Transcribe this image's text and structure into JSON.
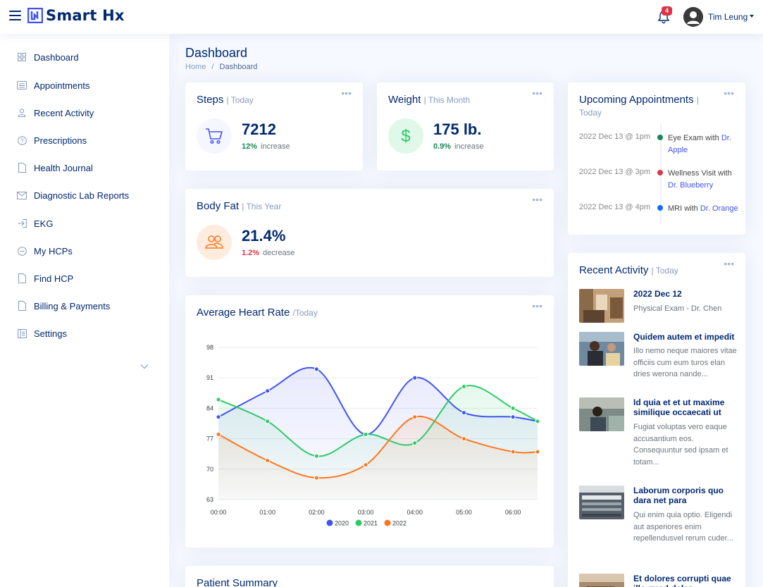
{
  "header": {
    "app_name": "Smart Hx",
    "notification_count": "4",
    "user_name": "Tim Leung"
  },
  "sidebar": {
    "items": [
      {
        "label": "Dashboard",
        "icon": "grid-icon"
      },
      {
        "label": "Appointments",
        "icon": "list-icon"
      },
      {
        "label": "Recent Activity",
        "icon": "person-icon"
      },
      {
        "label": "Prescriptions",
        "icon": "question-circle-icon"
      },
      {
        "label": "Health Journal",
        "icon": "file-icon"
      },
      {
        "label": "Diagnostic Lab Reports",
        "icon": "envelope-icon"
      },
      {
        "label": "EKG",
        "icon": "box-arrow-in-icon"
      },
      {
        "label": "My HCPs",
        "icon": "dash-circle-icon"
      },
      {
        "label": "Find HCP",
        "icon": "file-icon"
      },
      {
        "label": "Billing & Payments",
        "icon": "file-icon"
      },
      {
        "label": "Settings",
        "icon": "layout-text-icon"
      }
    ]
  },
  "page": {
    "title": "Dashboard",
    "breadcrumb_home": "Home",
    "breadcrumb_sep": "/",
    "breadcrumb_current": "Dashboard"
  },
  "steps": {
    "title": "Steps",
    "period": "| Today",
    "value": "7212",
    "pct": "12%",
    "trend": "increase",
    "pct_color": "#198754"
  },
  "weight": {
    "title": "Weight",
    "period": "| This Month",
    "value": "175 lb.",
    "pct": "0.9%",
    "trend": "increase",
    "pct_color": "#198754"
  },
  "body_fat": {
    "title": "Body Fat",
    "period": "| This Year",
    "value": "21.4%",
    "pct": "1.2%",
    "trend": "decrease",
    "pct_color": "#dc3545"
  },
  "heart_rate": {
    "title": "Average Heart Rate",
    "period": "/Today"
  },
  "patient_summary": {
    "title": "Patient Summary"
  },
  "appointments": {
    "title": "Upcoming Appointments",
    "period_sep": "|",
    "period": "Today",
    "items": [
      {
        "time": "2022 Dec 13 @ 1pm",
        "text": "Eye Exam with",
        "doctor": "Dr. Apple",
        "color": "#198754"
      },
      {
        "time": "2022 Dec 13 @ 3pm",
        "text": "Wellness Visit with",
        "doctor": "Dr. Blueberry",
        "color": "#dc3545"
      },
      {
        "time": "2022 Dec 13 @ 4pm",
        "text": "MRI with",
        "doctor": "Dr. Orange",
        "color": "#0d6efd"
      }
    ]
  },
  "recent_activity": {
    "title": "Recent Activity",
    "period": "| Today",
    "items": [
      {
        "title": "2022 Dec 12",
        "desc": "Physical Exam - Dr. Chen"
      },
      {
        "title": "Quidem autem et impedit",
        "desc": "Illo nemo neque maiores vitae officiis cum eum turos elan dries werona nande..."
      },
      {
        "title": "Id quia et et ut maxime similique occaecati ut",
        "desc": "Fugiat voluptas vero eaque accusantium eos. Consequuntur sed ipsam et totam..."
      },
      {
        "title": "Laborum corporis quo dara net para",
        "desc": "Qui enim quia optio. Eligendi aut asperiores enim repellendusvel rerum cuder..."
      },
      {
        "title": "Et dolores corrupti quae illo quod dolor",
        "desc": ""
      }
    ]
  },
  "chart_data": {
    "type": "area",
    "title": "Average Heart Rate",
    "x": [
      "00:00",
      "01:00",
      "02:00",
      "03:00",
      "04:00",
      "05:00",
      "06:00"
    ],
    "x_values": [
      0,
      1,
      2,
      3,
      4,
      5,
      6,
      6.5
    ],
    "ylim": [
      63,
      98
    ],
    "y_ticks": [
      63,
      70,
      77,
      84,
      91,
      98
    ],
    "grid": true,
    "legend_position": "bottom",
    "series": [
      {
        "name": "2020",
        "color": "#4154f1",
        "values": [
          82,
          88,
          93,
          78,
          91,
          83,
          82,
          81
        ]
      },
      {
        "name": "2021",
        "color": "#2eca6a",
        "values": [
          86,
          81,
          73,
          78,
          76,
          89,
          84,
          81
        ]
      },
      {
        "name": "2022",
        "color": "#ff771d",
        "values": [
          78,
          72,
          68,
          71,
          82,
          77,
          74,
          74
        ]
      }
    ]
  }
}
